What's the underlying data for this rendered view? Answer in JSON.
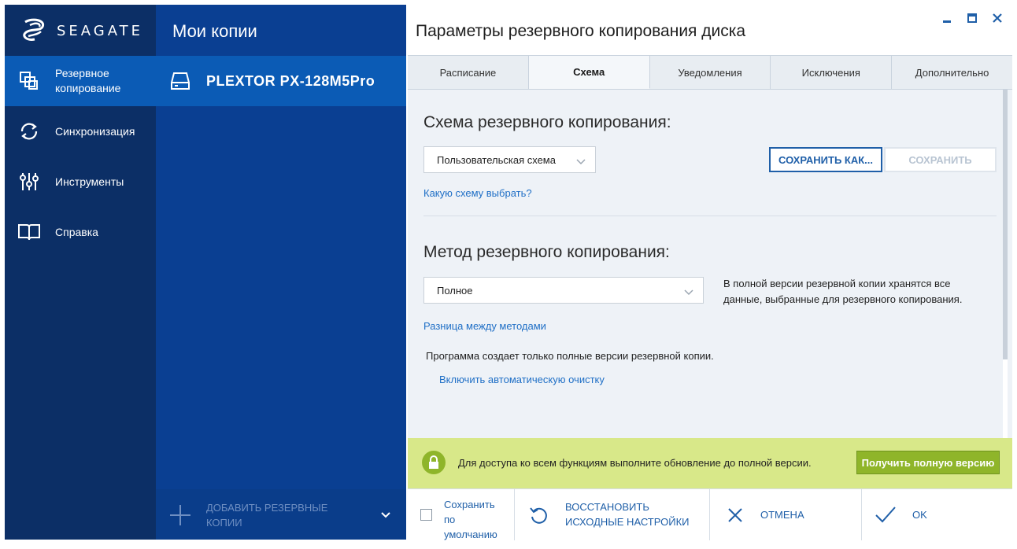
{
  "brand": {
    "name": "SEAGATE"
  },
  "nav": {
    "items": [
      {
        "label": "Резервное копирование",
        "icon": "backup-icon",
        "active": true
      },
      {
        "label": "Синхронизация",
        "icon": "sync-icon",
        "active": false
      },
      {
        "label": "Инструменты",
        "icon": "tools-icon",
        "active": false
      },
      {
        "label": "Справка",
        "icon": "book-icon",
        "active": false
      }
    ]
  },
  "backups": {
    "title": "Мои копии",
    "items": [
      {
        "name": "PLEXTOR PX-128M5Pro",
        "icon": "drive-icon"
      }
    ],
    "add_label": "ДОБАВИТЬ РЕЗЕРВНЫЕ КОПИИ"
  },
  "dialog": {
    "title": "Параметры резервного копирования диска",
    "tabs": [
      {
        "label": "Расписание",
        "active": false
      },
      {
        "label": "Схема",
        "active": true
      },
      {
        "label": "Уведомления",
        "active": false
      },
      {
        "label": "Исключения",
        "active": false
      },
      {
        "label": "Дополнительно",
        "active": false
      }
    ],
    "scheme": {
      "heading": "Схема резервного копирования:",
      "selected": "Пользовательская схема",
      "save_as": "СОХРАНИТЬ КАК...",
      "save": "СОХРАНИТЬ",
      "help_link": "Какую схему выбрать?"
    },
    "method": {
      "heading": "Метод резервного копирования:",
      "selected": "Полное",
      "description": "В полной версии резервной копии хранятся все данные, выбранные для резервного копирования.",
      "diff_link": "Разница между методами",
      "info": "Программа создает только полные версии резервной копии.",
      "cleanup_link": "Включить автоматическую очистку"
    },
    "upgrade": {
      "message": "Для доступа ко всем функциям выполните обновление до полной версии.",
      "button": "Получить полную версию"
    },
    "footer": {
      "save_default": "Сохранить по умолчанию",
      "restore": "ВОССТАНОВИТЬ ИСХОДНЫЕ НАСТРОЙКИ",
      "cancel": "ОТМЕНА",
      "ok": "OK"
    }
  },
  "colors": {
    "nav_bg": "#0c2f66",
    "nav_active": "#0b5bb5",
    "list_bg": "#0a3f92",
    "accent": "#1f5fa8",
    "upgrade_bg": "#d8e889",
    "upgrade_btn": "#8fb52a"
  }
}
